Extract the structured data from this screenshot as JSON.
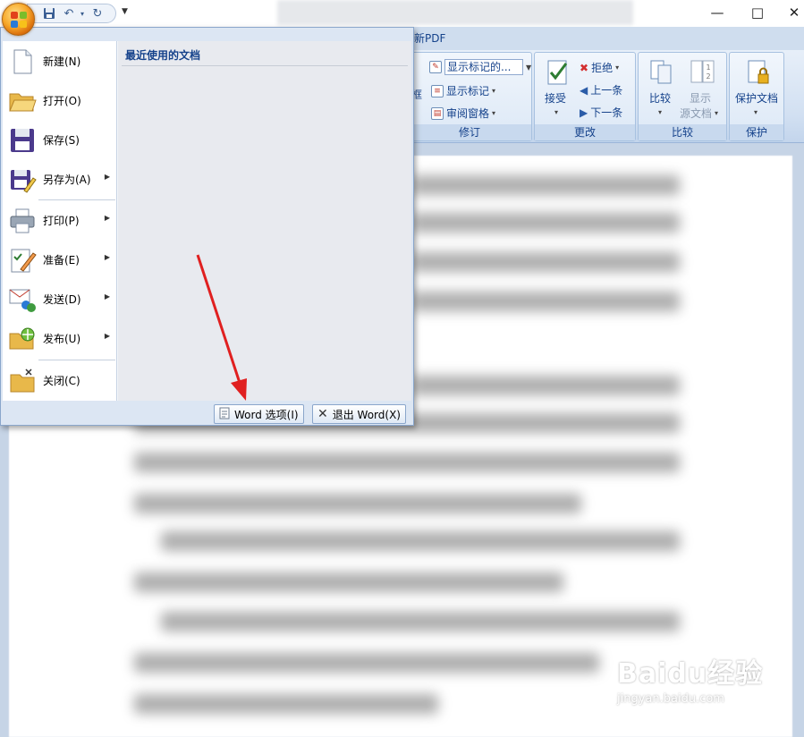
{
  "qat": {
    "save": "save-icon",
    "undo": "undo-icon",
    "redo": "redo-icon"
  },
  "ribbon": {
    "tab_fragment": "新PDF",
    "revision": {
      "label": "修订",
      "frame_fragment": "框",
      "show_markup_combo": "显示标记的...",
      "show_markup": "显示标记",
      "review_pane": "审阅窗格"
    },
    "changes": {
      "label": "更改",
      "accept": "接受",
      "reject": "拒绝",
      "prev": "上一条",
      "next": "下一条"
    },
    "compare": {
      "label": "比较",
      "compare": "比较",
      "show_source": "显示",
      "show_source2": "源文档"
    },
    "protect": {
      "label": "保护",
      "protect_doc": "保护文档"
    }
  },
  "menu": {
    "items": [
      {
        "label": "新建(N)",
        "icon": "new-document-icon"
      },
      {
        "label": "打开(O)",
        "icon": "open-folder-icon"
      },
      {
        "label": "保存(S)",
        "icon": "floppy-disk-icon"
      },
      {
        "label": "另存为(A)",
        "icon": "save-as-icon"
      },
      {
        "label": "打印(P)",
        "icon": "printer-icon"
      },
      {
        "label": "准备(E)",
        "icon": "prepare-icon"
      },
      {
        "label": "发送(D)",
        "icon": "send-icon"
      },
      {
        "label": "发布(U)",
        "icon": "publish-icon"
      },
      {
        "label": "关闭(C)",
        "icon": "close-folder-icon"
      }
    ],
    "recent_title": "最近使用的文档",
    "word_options": "Word 选项(I)",
    "exit_word": "退出 Word(X)"
  },
  "watermark": {
    "brand": "Baidu经验",
    "url": "jingyan.baidu.com"
  },
  "colors": {
    "accent": "#15428b",
    "annotation": "#e02020",
    "office_orb": "#f7a92b"
  }
}
